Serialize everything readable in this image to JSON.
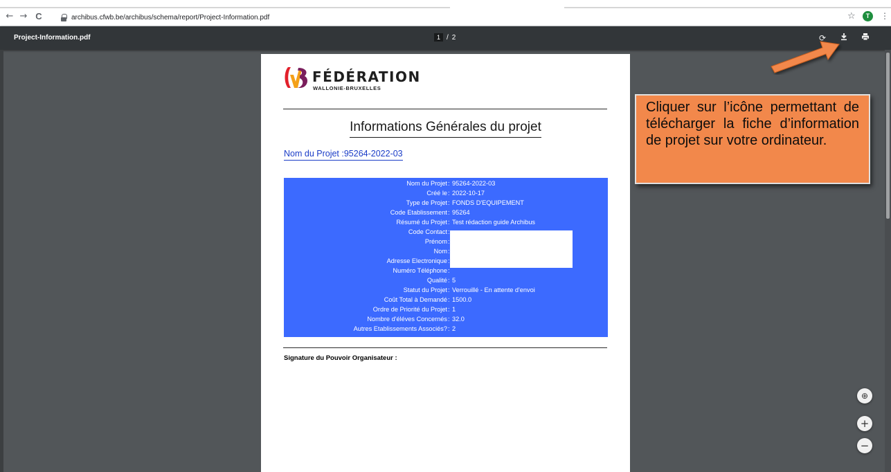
{
  "browser": {
    "url": "archibus.cfwb.be/archibus/schema/report/Project-Information.pdf",
    "nav_back": "←",
    "nav_forward": "→",
    "nav_reload": "C",
    "star_icon": "☆",
    "avatar_letter": "T",
    "menu_icon": "⋮"
  },
  "pdf_toolbar": {
    "file_name": "Project-Information.pdf",
    "current_page": "1",
    "page_separator": "/",
    "total_pages": "2",
    "rotate_icon": "⟳",
    "download_icon": "⤓",
    "print_icon": "🖶"
  },
  "document": {
    "logo_name": "FÉDÉRATION",
    "logo_sub": "WALLONIE-BRUXELLES",
    "title": "Informations Générales du projet",
    "project_heading": "Nom du Projet :95264-2022-03",
    "fields": [
      {
        "label": "Nom du Projet",
        "value": "95264-2022-03"
      },
      {
        "label": "Créé le",
        "value": "2022-10-17"
      },
      {
        "label": "Type de Projet",
        "value": "FONDS D'EQUIPEMENT"
      },
      {
        "label": "Code Etablissement",
        "value": "95264"
      },
      {
        "label": "Résumé du Projet",
        "value": "Test rédaction guide Archibus"
      },
      {
        "label": "Code Contact",
        "value": ""
      },
      {
        "label": "Prénom",
        "value": ""
      },
      {
        "label": "Nom",
        "value": ""
      },
      {
        "label": "Adresse Electronique",
        "value": ""
      },
      {
        "label": "Numéro Téléphone",
        "value": ""
      },
      {
        "label": "Qualité",
        "value": "5"
      },
      {
        "label": "Statut du Projet",
        "value": "Verrouillé - En attente d'envoi"
      },
      {
        "label": "Coût Total à Demandé",
        "value": "1500.0"
      },
      {
        "label": "Ordre de Priorité du Projet",
        "value": "1"
      },
      {
        "label": "Nombre d'éléves Concernés",
        "value": "32.0"
      },
      {
        "label": "Autres Etablissements Associés?",
        "value": "2"
      }
    ],
    "signature_label": "Signature du Pouvoir Organisateur :"
  },
  "annotation": {
    "text": "Cliquer sur l’icône permettant de télécharger la fiche d’information de projet sur votre ordinateur."
  },
  "zoom": {
    "fit_icon": "⊕",
    "zoom_in": "+",
    "zoom_out": "−"
  },
  "colors": {
    "info_box": "#3c6aff",
    "callout": "#f2884b",
    "toolbar": "#323639",
    "viewer_bg": "#525659"
  }
}
